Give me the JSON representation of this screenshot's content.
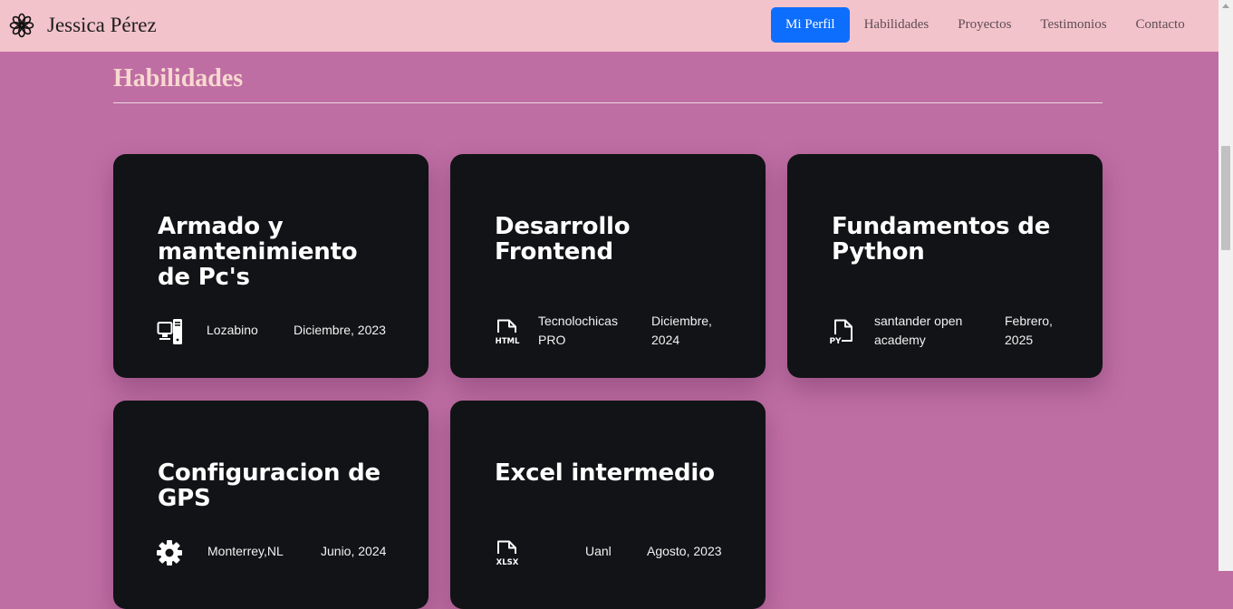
{
  "nav": {
    "brand": "Jessica Pérez",
    "brand_icon": "flower-icon",
    "links": [
      "Mi Perfil",
      "Habilidades",
      "Proyectos",
      "Testimonios",
      "Contacto"
    ],
    "active_link": "Mi Perfil"
  },
  "section": {
    "title": "Habilidades"
  },
  "skills": [
    {
      "title": "Armado y mantenimiento de Pc's",
      "icon": "pc-display-icon",
      "institution": "Lozabino",
      "date": "Diciembre, 2023"
    },
    {
      "title": "Desarrollo Frontend",
      "icon": "file-html-icon",
      "institution": "Tecnolochicas PRO",
      "date": "Diciembre, 2024"
    },
    {
      "title": "Fundamentos de Python",
      "icon": "file-py-icon",
      "institution": "santander open academy",
      "date": "Febrero, 2025"
    },
    {
      "title": "Configuracion de GPS",
      "icon": "gear-icon",
      "institution": "Monterrey,NL",
      "date": "Junio, 2024"
    },
    {
      "title": "Excel intermedio",
      "icon": "file-xlsx-icon",
      "institution": "Uanl",
      "date": "Agosto, 2023"
    }
  ],
  "colors": {
    "page_background": "#bf6ea4",
    "navbar_background": "#f3c3cb",
    "active_nav": "#0d6efd",
    "card_background": "#121316",
    "section_title": "#f8d8cf"
  }
}
